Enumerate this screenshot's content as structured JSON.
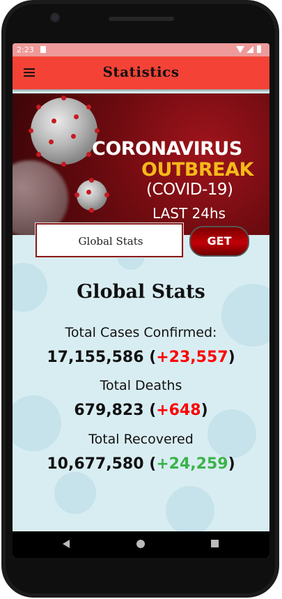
{
  "status": {
    "time": "2:23"
  },
  "appbar": {
    "title": "Statistics",
    "menu_icon": "hamburger-menu-icon"
  },
  "banner": {
    "line1": "CORONAVIRUS",
    "line2": "OUTBREAK",
    "line3": "(COVID-19)",
    "line4": "LAST 24hs",
    "colors": {
      "highlight": "#f6b91a",
      "background": "#8b0f15"
    }
  },
  "search": {
    "value": "Global Stats",
    "button_label": "GET"
  },
  "stats": {
    "title": "Global Stats",
    "cases_label": "Total Cases Confirmed:",
    "cases_total": "17,155,586",
    "cases_new": "+23,557",
    "deaths_label": "Total Deaths",
    "deaths_total": "679,823",
    "deaths_new": "+648",
    "recovered_label": "Total Recovered",
    "recovered_total": "10,677,580",
    "recovered_new": "+24,259"
  },
  "colors": {
    "appbar": "#f44336",
    "increase_bad": "#ff0000",
    "increase_good": "#3cb24a"
  },
  "navbar": {
    "icons": [
      "back-icon",
      "home-icon",
      "recents-icon"
    ]
  }
}
